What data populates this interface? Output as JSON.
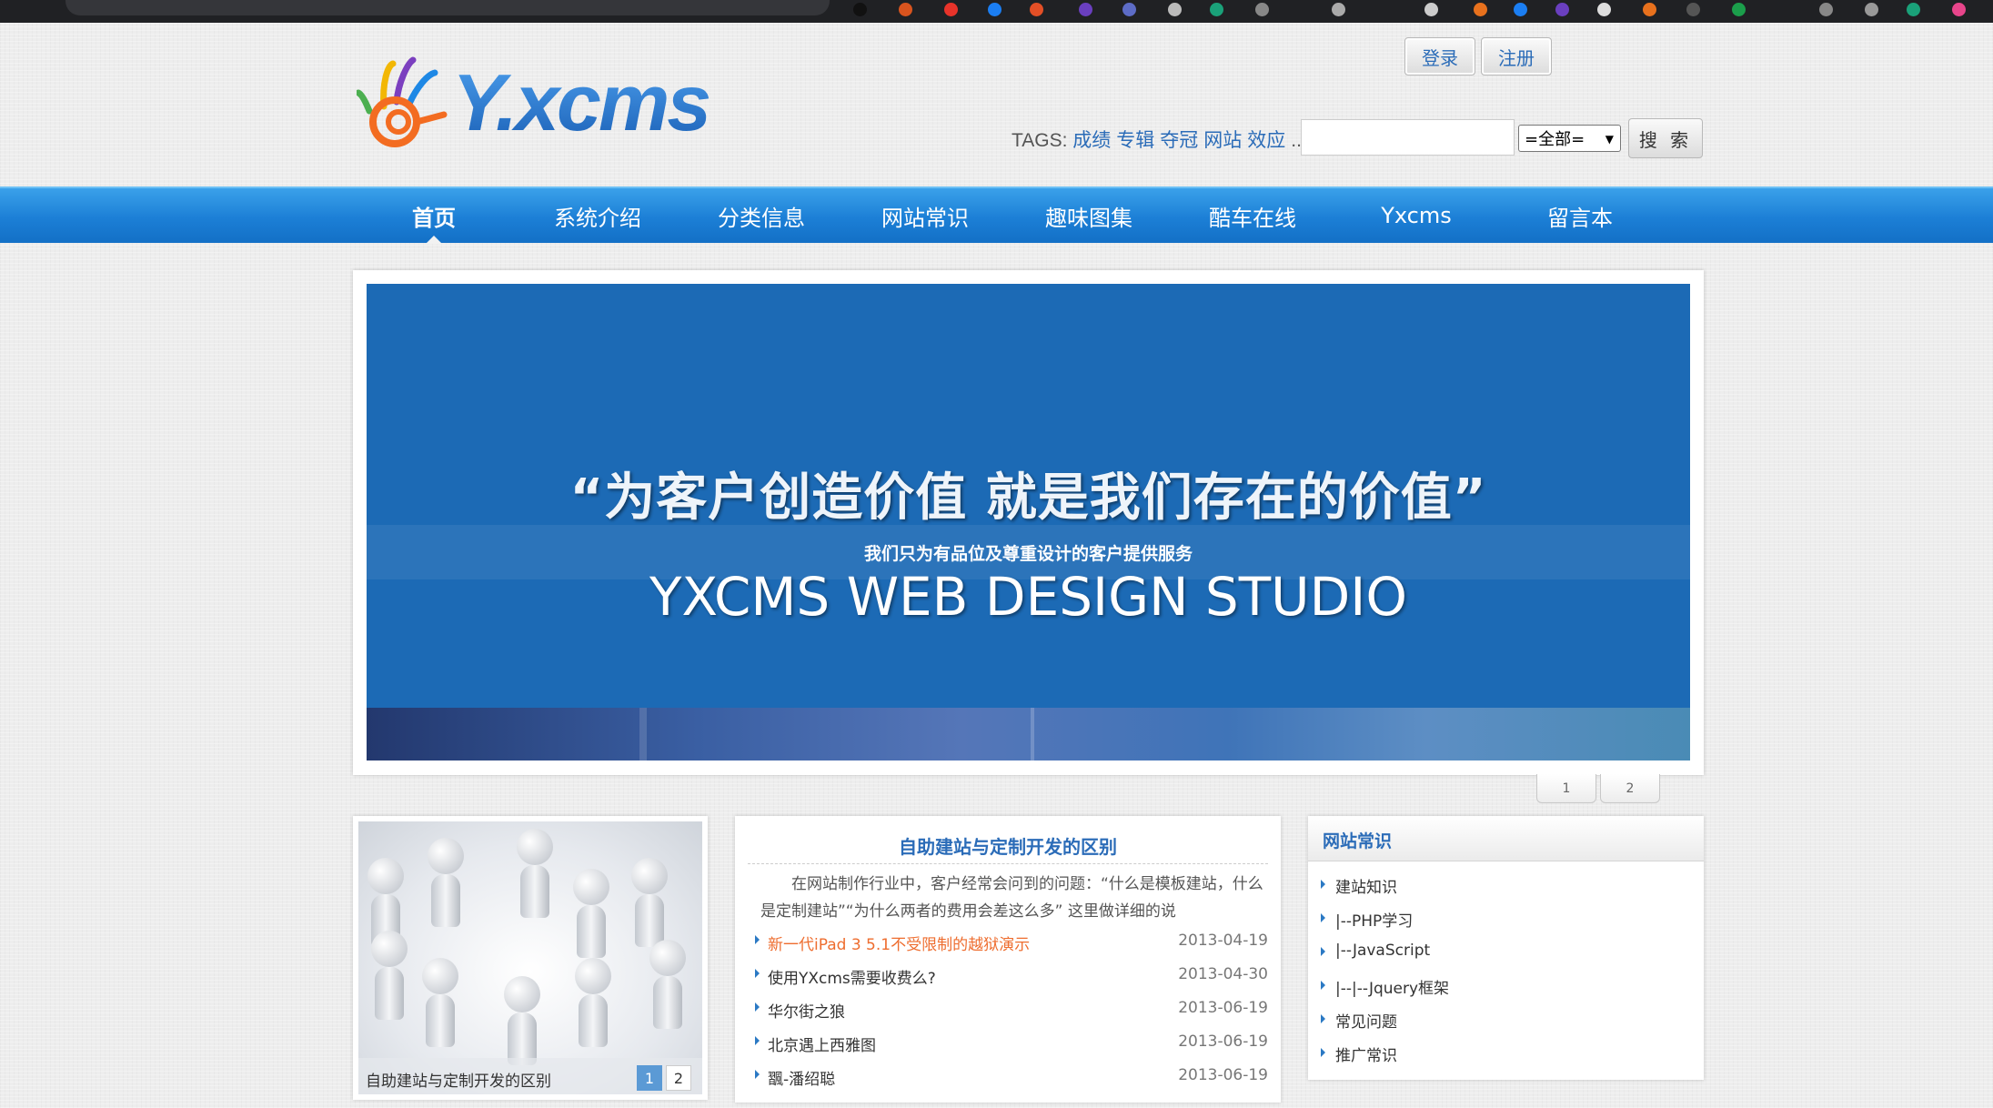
{
  "header": {
    "login_label": "登录",
    "register_label": "注册",
    "tags_label": "TAGS:",
    "tags": [
      "成绩",
      "专辑",
      "夺冠",
      "网站",
      "效应"
    ],
    "tags_more": "...",
    "search_select_value": "=全部=",
    "search_button_label": "搜 索",
    "search_input_value": ""
  },
  "nav": {
    "items": [
      "首页",
      "系统介绍",
      "分类信息",
      "网站常识",
      "趣味图集",
      "酷车在线",
      "Yxcms",
      "留言本"
    ]
  },
  "banner": {
    "quote": "“为客户创造价值  就是我们存在的价值”",
    "subtitle": "我们只为有品位及尊重设计的客户提供服务",
    "studio": "YXCMS WEB DESIGN STUDIO",
    "pages": [
      "1",
      "2"
    ]
  },
  "image_box": {
    "caption": "自助建站与定制开发的区别",
    "pages": [
      "1",
      "2"
    ]
  },
  "news": {
    "title": "自助建站与定制开发的区别",
    "summary": "在网站制作行业中，客户经常会问到的问题：“什么是模板建站，什么是定制建站”“为什么两者的费用会差这么多” 这里做详细的说",
    "items": [
      {
        "title": "新一代iPad 3 5.1不受限制的越狱演示",
        "date": "2013-04-19"
      },
      {
        "title": "使用YXcms需要收费么?",
        "date": "2013-04-30"
      },
      {
        "title": "华尔街之狼",
        "date": "2013-06-19"
      },
      {
        "title": "北京遇上西雅图",
        "date": "2013-06-19"
      },
      {
        "title": "飁-潘绍聪",
        "date": "2013-06-19"
      }
    ]
  },
  "side": {
    "title": "网站常识",
    "items": [
      "建站知识",
      "|--PHP学习",
      "|--JavaScript",
      "|--|--Jquery框架",
      "常见问题",
      "推广常识"
    ]
  },
  "colors": {
    "brand_blue": "#2b6cb8",
    "nav_blue": "#1c7fd6",
    "highlight_orange": "#ee6d2f",
    "banner_blue": "#1c6ab5"
  },
  "icons": [
    "logo-hand-icon",
    "search-select-caret-icon",
    "list-bullet-icon"
  ]
}
